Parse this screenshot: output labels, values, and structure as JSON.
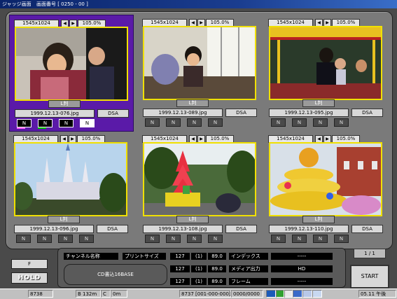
{
  "window": {
    "app_title": "ジャッジ画面",
    "screen_number": "画面番号 [ 0250 - 00 ]"
  },
  "slots": [
    {
      "resolution": "1545x1024",
      "prev_icon": "triangle-left-icon",
      "next_icon": "triangle-right-icon",
      "zoom": "105.0%",
      "print_size": "L判",
      "filename": "1999.12.13-076.jpg",
      "dsa": "DSA",
      "n_buttons": [
        "N",
        "N",
        "N",
        "N"
      ],
      "selected": true
    },
    {
      "resolution": "1545x1024",
      "prev_icon": "triangle-left-icon",
      "next_icon": "triangle-right-icon",
      "zoom": "105.0%",
      "print_size": "L判",
      "filename": "1999.12.13-089.jpg",
      "dsa": "DSA",
      "n_buttons": [
        "N",
        "N",
        "N",
        "N"
      ],
      "selected": false
    },
    {
      "resolution": "1545x1024",
      "prev_icon": "triangle-left-icon",
      "next_icon": "triangle-right-icon",
      "zoom": "105.0%",
      "print_size": "L判",
      "filename": "1999.12.13-095.jpg",
      "dsa": "DSA",
      "n_buttons": [
        "N",
        "N",
        "N",
        "N"
      ],
      "selected": false
    },
    {
      "resolution": "1545x1024",
      "prev_icon": "triangle-left-icon",
      "next_icon": "triangle-right-icon",
      "zoom": "105.0%",
      "print_size": "L判",
      "filename": "1999.12.13-096.jpg",
      "dsa": "DSA",
      "n_buttons": [
        "N",
        "N",
        "N",
        "N"
      ],
      "selected": false
    },
    {
      "resolution": "1545x1024",
      "prev_icon": "triangle-left-icon",
      "next_icon": "triangle-right-icon",
      "zoom": "105.0%",
      "print_size": "L判",
      "filename": "1999.12.13-108.jpg",
      "dsa": "DSA",
      "n_buttons": [
        "N",
        "N",
        "N",
        "N"
      ],
      "selected": false
    },
    {
      "resolution": "1545x1024",
      "prev_icon": "triangle-left-icon",
      "next_icon": "triangle-right-icon",
      "zoom": "105.0%",
      "print_size": "L判",
      "filename": "1999.12.13-110.jpg",
      "dsa": "DSA",
      "n_buttons": [
        "N",
        "N",
        "N",
        "N"
      ],
      "selected": false
    }
  ],
  "left_buttons": {
    "f": "F",
    "hold": "HOLD"
  },
  "info_panel": {
    "channel_label": "チャンネル名称",
    "print_size_label": "プリントサイズ",
    "rows": [
      {
        "a": "127",
        "b": "(1)",
        "c": "89.0"
      },
      {
        "a": "127",
        "b": "(1)",
        "c": "89.0"
      },
      {
        "a": "127",
        "b": "(1)",
        "c": "89.0"
      }
    ],
    "index_label": "インデックス",
    "index_value": "-----",
    "media_label": "メディア出力",
    "media_value": "HD",
    "frame_label": "フレーム",
    "frame_value": "-----",
    "cd_button": "CD書込16BASE"
  },
  "page_indicator": "1 / 1",
  "start_button": "START",
  "status_bar": {
    "c1": "8738",
    "c2": "B 132m",
    "c3": "C",
    "c4": "0m",
    "c5": "8737 [001-000-000]",
    "c6": "0000/0000",
    "clock": "05.11 午後"
  },
  "colors": {
    "selected_slot": "#5a1aa8",
    "photo_border": "#f0e000",
    "title_bar": "#0a246a"
  }
}
